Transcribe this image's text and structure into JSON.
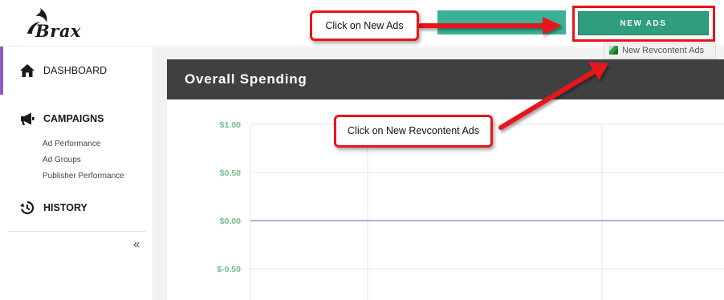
{
  "header": {
    "logo_text": "Brax",
    "new_ads_button": "NEW ADS",
    "submenu_new_revcontent": "New Revcontent Ads"
  },
  "sidebar": {
    "items": [
      {
        "label": "DASHBOARD",
        "icon": "home-icon",
        "active": true
      },
      {
        "label": "CAMPAIGNS",
        "icon": "megaphone-icon",
        "active": false
      },
      {
        "label": "HISTORY",
        "icon": "history-icon",
        "active": false
      }
    ],
    "campaign_subitems": [
      "Ad Performance",
      "Ad Groups",
      "Publisher Performance"
    ],
    "collapse_label": "«"
  },
  "panel": {
    "title": "Overall Spending"
  },
  "chart_data": {
    "type": "line",
    "title": "Overall Spending",
    "xlabel": "",
    "ylabel": "",
    "ylim": [
      -0.5,
      1.0
    ],
    "yticks": [
      "$1.00",
      "$0.50",
      "$0.00",
      "$-0.50"
    ],
    "ytick_values": [
      1.0,
      0.5,
      0.0,
      -0.5
    ],
    "series": [
      {
        "values": [
          0,
          0
        ]
      }
    ],
    "grid": true,
    "colors": {
      "series": "#a58ccd",
      "tick_label": "#6dbe8f",
      "grid": "#e4e4e4"
    }
  },
  "annotations": {
    "callout_new_ads": "Click on New Ads",
    "callout_revcontent": "Click on New Revcontent Ads"
  },
  "colors": {
    "accent_green": "#2e9e7e",
    "highlight_red": "#e8141b",
    "active_purple": "#8e5bc7",
    "panel_dark": "#404040"
  }
}
